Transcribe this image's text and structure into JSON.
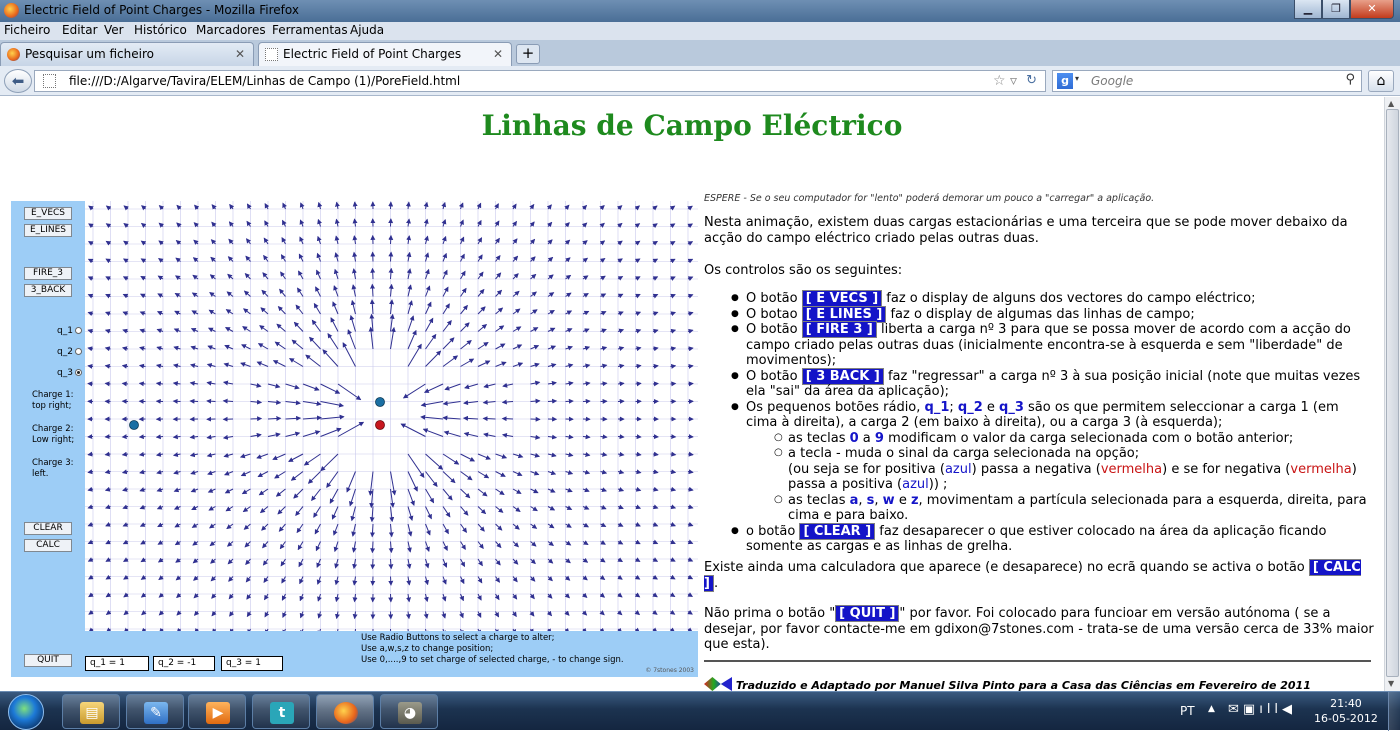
{
  "window": {
    "title": "Electric Field of Point Charges - Mozilla Firefox",
    "icon": "firefox-icon",
    "controls": [
      "minimize-icon",
      "maximize-icon",
      "close-icon"
    ]
  },
  "menu": [
    "Ficheiro",
    "Editar",
    "Ver",
    "Histórico",
    "Marcadores",
    "Ferramentas",
    "Ajuda"
  ],
  "tabs": [
    {
      "label": "Pesquisar um ficheiro",
      "active": false,
      "icon": "firefox-icon"
    },
    {
      "label": "Electric Field of Point Charges",
      "active": true,
      "icon": "page-icon"
    }
  ],
  "new_tab": "+",
  "nav": {
    "url": "file:///D:/Algarve/Tavira/ELEM/Linhas de Campo (1)/PoreField.html",
    "search_placeholder": "Google"
  },
  "page": {
    "title": "Linhas de Campo Eléctrico",
    "espere": "ESPERE - Se o seu computador for \"lento\" poderá demorar um pouco a \"carregar\" a aplicação.",
    "intro": "Nesta animação, existem duas cargas estacionárias e uma terceira que se pode mover debaixo da acção do campo eléctrico criado pelas outras duas.",
    "controls_heading": "Os controlos são os seguintes:",
    "items": {
      "evecs": {
        "pre": "O botão ",
        "key": "[ E VECS ]",
        "post": " faz o display de alguns dos vectores do campo eléctrico;"
      },
      "elines": {
        "pre": "O botao ",
        "key": "[ E LINES ]",
        "post": " faz o display de algumas das linhas de campo;"
      },
      "fire": {
        "pre": "O botão ",
        "key": "[ FIRE 3 ]",
        "post": " liberta a carga nº 3 para que se possa mover de acordo com a acção do campo criado pelas outras duas (inicialmente encontra-se à esquerda e sem \"liberdade\" de movimentos);"
      },
      "back": {
        "pre": "O botão ",
        "key": "[ 3 BACK ]",
        "post": " faz \"regressar\" a carga nº 3 à sua posição inicial (note que muitas vezes ela \"sai\" da área da aplicação);"
      },
      "radio": {
        "pre": "Os pequenos botões rádio, ",
        "q1": "q_1",
        "sep1": "; ",
        "q2": "q_2",
        "sep2": " e ",
        "q3": "q_3",
        "post": " são os que permitem seleccionar a carga 1 (em cima à direita), a carga 2 (em baixo à direita), ou a carga 3 (à esquerda);"
      },
      "keys09": {
        "pre": "as teclas ",
        "k0": "0",
        "mid": " a ",
        "k9": "9",
        "post": " modificam o valor da carga selecionada com o botão anterior;"
      },
      "minus": {
        "line1": "a tecla - muda o sinal da carga selecionada na opção;",
        "pre": "(ou seja se for positiva (",
        "azul": "azul",
        "mid": ") passa a negativa (",
        "vermelha": "vermelha",
        "mid2": ") e se for negativa (",
        "vermelha2": "vermelha",
        "mid3": ") passa a positiva (",
        "azul2": "azul",
        "post": ")) ;"
      },
      "awsz": {
        "pre": "as teclas ",
        "a": "a",
        "s1": ", ",
        "s": "s",
        "s2": ", ",
        "w": "w",
        "s3": " e ",
        "z": "z",
        "post": ", movimentam a partícula selecionada para a esquerda, direita, para cima e para baixo."
      },
      "clear": {
        "pre": "o botão ",
        "key": "[ CLEAR ]",
        "post": " faz desaparecer o que estiver colocado na área da aplicação ficando somente as cargas e as linhas de grelha."
      }
    },
    "calc": {
      "pre": "Existe ainda uma calculadora que aparece (e desaparece) no ecrã quando se activa o botão ",
      "key": "[ CALC ]",
      "post": "."
    },
    "quit": {
      "pre": "Não prima o botão \"",
      "key": "[ QUIT ]",
      "post": "\" por favor. Foi colocado para funcioar em versão autónoma ( se a desejar, por favor contacte-me em gdixon@7stones.com - trata-se de uma versão cerca de 33% maior que esta)."
    },
    "credit": "Traduzido e Adaptado por Manuel Silva Pinto para a Casa das Ciências em Fevereiro de 2011"
  },
  "applet": {
    "buttons": {
      "e_vecs": "E_VECS",
      "e_lines": "E_LINES",
      "fire_3": "FIRE_3",
      "back_3": "3_BACK",
      "clear": "CLEAR",
      "calc": "CALC",
      "quit": "QUIT"
    },
    "radios": [
      {
        "label": "q_1",
        "checked": false
      },
      {
        "label": "q_2",
        "checked": false
      },
      {
        "label": "q_3",
        "checked": true
      }
    ],
    "charge_info": {
      "c1": "Charge 1:\ntop right;",
      "c2": "Charge 2:\nLow right;",
      "c3": "Charge 3:\nleft."
    },
    "charges": [
      {
        "name": "q_1",
        "value": "q_1 = 1",
        "color": "#1a6fa3"
      },
      {
        "name": "q_2",
        "value": "q_2 = -1",
        "color": "#c8181e"
      },
      {
        "name": "q_3",
        "value": "q_3 = 1",
        "color": "#1a6fa3"
      }
    ],
    "help": [
      "Use Radio Buttons to select a charge to alter;",
      "Use a,w,s,z to change position;",
      "Use 0,....,9 to set charge of selected charge, - to change sign."
    ],
    "copyright": "© 7stones 2003",
    "colors": {
      "panel": "#9dcdf6",
      "grid": "#c9c9ec",
      "vector": "#303090"
    }
  },
  "taskbar": {
    "items": [
      "windows-explorer-icon",
      "paint-icon",
      "media-player-icon",
      "tumblr-icon",
      "firefox-icon",
      "gimp-icon"
    ],
    "lang": "PT",
    "time": "21:40",
    "date": "16-05-2012"
  }
}
